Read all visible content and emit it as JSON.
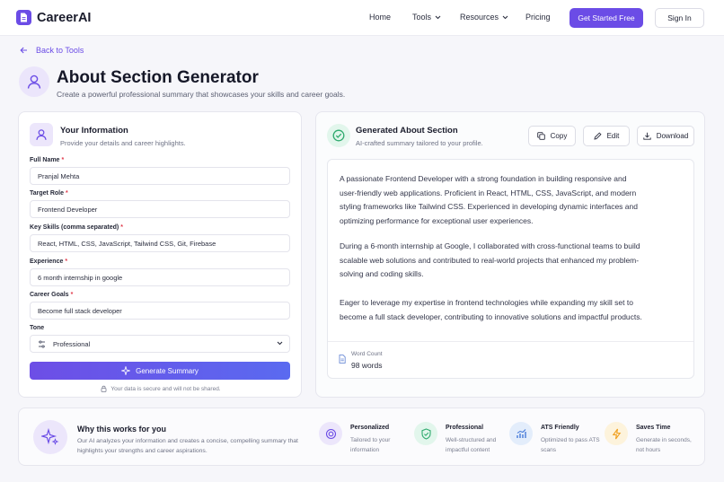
{
  "nav": {
    "brand": "CareerAI",
    "links": [
      "Home",
      "Tools",
      "Resources",
      "Pricing"
    ],
    "cta": "Get Started Free",
    "signin": "Sign In"
  },
  "back_link": "Back to Tools",
  "page": {
    "title": "About Section Generator",
    "subtitle": "Create a powerful professional summary that showcases your skills and career goals."
  },
  "form": {
    "title": "Your Information",
    "subtitle": "Provide your details and career highlights.",
    "fields": [
      {
        "label": "Full Name",
        "value": "Pranjal Mehta"
      },
      {
        "label": "Target Role",
        "value": "Frontend Developer"
      },
      {
        "label": "Key Skills (comma separated)",
        "value": "React, HTML, CSS, JavaScript, Tailwind CSS, Git, Firebase"
      },
      {
        "label": "Experience",
        "value": "6 month internship in google"
      },
      {
        "label": "Career Goals",
        "value": "Become full stack developer"
      }
    ],
    "tone_label": "Tone",
    "tone_value": "Professional",
    "generate_label": "Generate Summary",
    "secure_note": "Your data is secure and will not be shared."
  },
  "output": {
    "title": "Generated About Section",
    "subtitle": "AI-crafted summary tailored to your profile.",
    "copy_label": "Copy",
    "edit_label": "Edit",
    "download_label": "Download",
    "paragraphs": [
      "A passionate Frontend Developer with a strong foundation in building responsive and user-friendly web applications. Proficient in React, HTML, CSS, JavaScript, and modern styling frameworks like Tailwind CSS. Experienced in developing dynamic interfaces and optimizing performance for exceptional user experiences.",
      "During a 6-month internship at Google, I collaborated with cross-functional teams to build scalable web solutions and contributed to real-world projects that enhanced my problem-solving and coding skills.",
      "Eager to leverage my expertise in frontend technologies while expanding my skill set to become a full stack developer, contributing to innovative solutions and impactful products."
    ],
    "word_count_label": "Word Count",
    "word_count_value": "98 words"
  },
  "why": {
    "title": "Why this works for you",
    "description": "Our AI analyzes your information and creates a concise, compelling summary that highlights your strengths and career aspirations.",
    "features": [
      {
        "title": "Personalized",
        "desc": "Tailored to your information"
      },
      {
        "title": "Professional",
        "desc": "Well-structured and impactful content"
      },
      {
        "title": "ATS Friendly",
        "desc": "Optimized to pass ATS scans"
      },
      {
        "title": "Saves Time",
        "desc": "Generate in seconds, not hours"
      }
    ]
  },
  "colors": {
    "accent": "#6b4ce6",
    "success": "#2faa6e",
    "warning": "#f0a020",
    "required": "#e0394a"
  }
}
